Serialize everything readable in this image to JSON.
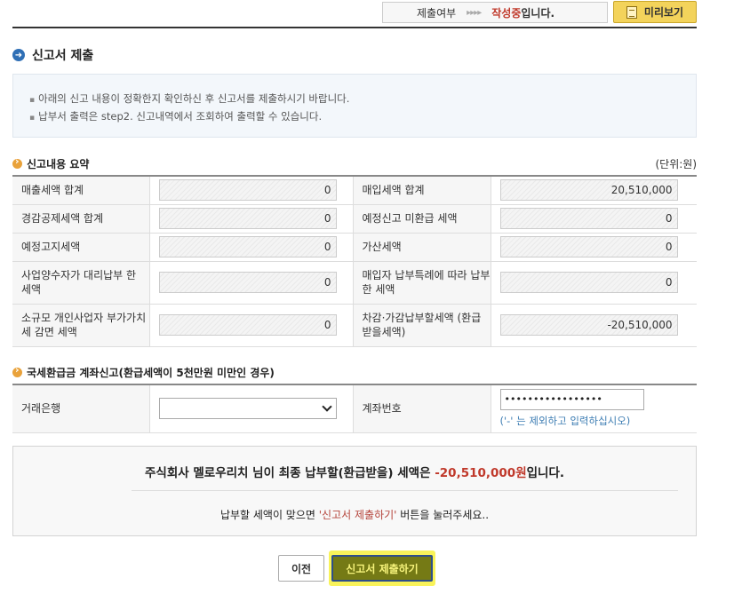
{
  "status": {
    "label": "제출여부",
    "arrows": "▸▸▸▸",
    "value": "작성중",
    "suffix": "입니다.",
    "preview_button": "미리보기"
  },
  "section_title": "신고서 제출",
  "notice": [
    "아래의 신고 내용이 정확한지 확인하신 후 신고서를 제출하시기 바랍니다.",
    "납부서 출력은 step2. 신고내역에서 조회하여 출력할 수 있습니다."
  ],
  "summary": {
    "heading": "신고내용 요약",
    "unit": "(단위:원)",
    "rows": [
      {
        "left_label": "매출세액 합계",
        "left_value": "0",
        "right_label": "매입세액 합계",
        "right_value": "20,510,000"
      },
      {
        "left_label": "경감공제세액 합계",
        "left_value": "0",
        "right_label": "예정신고 미환급 세액",
        "right_value": "0"
      },
      {
        "left_label": "예정고지세액",
        "left_value": "0",
        "right_label": "가산세액",
        "right_value": "0"
      },
      {
        "left_label": "사업양수자가 대리납부 한 세액",
        "left_value": "0",
        "right_label": "매입자 납부특례에 따라 납부한 세액",
        "right_value": "0"
      },
      {
        "left_label": "소규모 개인사업자 부가가치세 감면 세액",
        "left_value": "0",
        "right_label": "차감·가감납부할세액 (환급받을세액)",
        "right_value": "-20,510,000"
      }
    ]
  },
  "account": {
    "heading": "국세환급금 계좌신고(환급세액이 5천만원 미만인 경우)",
    "bank_label": "거래은행",
    "bank_value": "",
    "account_label": "계좌번호",
    "account_value": "•••••••••••••••••",
    "hint": "('-' 는 제외하고 입력하십시오)"
  },
  "final": {
    "prefix": "주식회사 멜로우리치 님이 최종 납부할(환급받을) 세액은 ",
    "amount": "-20,510,000원",
    "suffix": "입니다.",
    "line2_prefix": "납부할 세액이 맞으면 ",
    "line2_highlight": "'신고서 제출하기'",
    "line2_suffix": " 버튼을 눌러주세요.."
  },
  "buttons": {
    "prev": "이전",
    "submit": "신고서 제출하기"
  }
}
